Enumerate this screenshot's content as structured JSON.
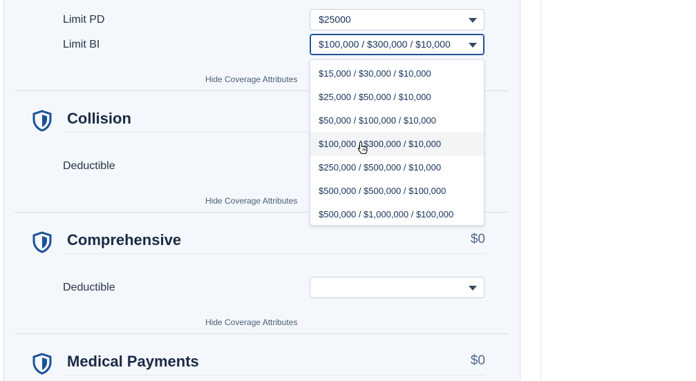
{
  "bodily_injury": {
    "limit_pd_label": "Limit PD",
    "limit_pd_value": "$25000",
    "limit_bi_label": "Limit BI",
    "limit_bi_value": "$100,000 / $300,000 / $10,000",
    "hide_link": "Hide Coverage Attributes"
  },
  "limit_bi_options": [
    "$15,000 / $30,000 / $10,000",
    "$25,000 / $50,000 / $10,000",
    "$50,000 / $100,000 / $10,000",
    "$100,000 / $300,000 / $10,000",
    "$250,000 / $500,000 / $10,000",
    "$500,000 / $500,000 / $100,000",
    "$500,000 / $1,000,000 / $100,000"
  ],
  "collision": {
    "title": "Collision",
    "deductible_label": "Deductible",
    "hide_link": "Hide Coverage Attributes"
  },
  "comprehensive": {
    "title": "Comprehensive",
    "premium": "$0",
    "deductible_label": "Deductible",
    "deductible_value": "",
    "hide_link": "Hide Coverage Attributes"
  },
  "medical_payments": {
    "title": "Medical Payments",
    "premium": "$0"
  },
  "colors": {
    "accent": "#1b5297",
    "panel_bg": "#f4f8fc",
    "icon": "#1b5297"
  },
  "icons": {
    "coverage": "shield-icon",
    "select": "chevron-down-icon",
    "cursor": "hand-pointer-icon"
  }
}
